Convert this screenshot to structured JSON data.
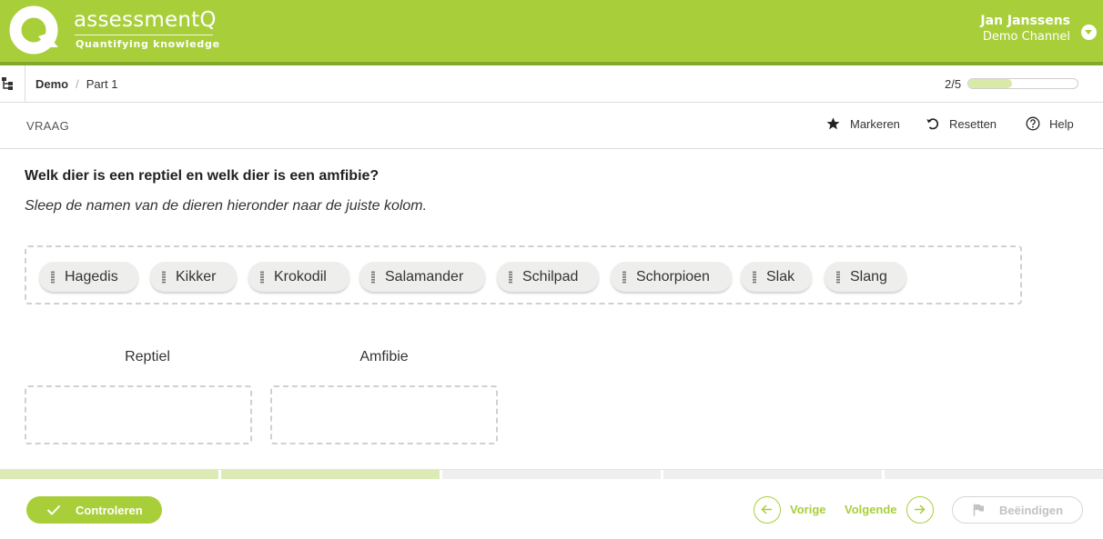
{
  "header": {
    "brand": "assessmentQ",
    "tagline": "Quantifying knowledge",
    "user_name": "Jan Janssens",
    "user_channel": "Demo Channel"
  },
  "breadcrumb": {
    "items": [
      "Demo",
      "Part 1"
    ],
    "separator": "/"
  },
  "progress": {
    "label": "2/5",
    "current": 2,
    "total": 5
  },
  "toolbar": {
    "section_label": "VRAAG",
    "mark_label": "Markeren",
    "reset_label": "Resetten",
    "help_label": "Help"
  },
  "question": {
    "title": "Welk dier is een reptiel en welk dier is een amfibie?",
    "instruction": "Sleep de namen van de dieren hieronder naar de juiste kolom."
  },
  "options": [
    "Hagedis",
    "Kikker",
    "Krokodil",
    "Salamander",
    "Schilpad",
    "Schorpioen",
    "Slak",
    "Slang"
  ],
  "columns": [
    "Reptiel",
    "Amfibie"
  ],
  "segments": {
    "total": 5,
    "done": 2
  },
  "footer": {
    "check_label": "Controleren",
    "prev_label": "Vorige",
    "next_label": "Volgende",
    "finish_label": "Beëindigen"
  },
  "colors": {
    "brand": "#a8cf3a",
    "brand_dark": "#83a92a",
    "progress_fill": "#d8e9a8",
    "disabled": "#c2c2c2"
  },
  "icons": {
    "logo": "q-logo-icon",
    "user_menu": "chevron-down-icon",
    "tree": "tree-icon",
    "mark": "star-icon",
    "reset": "reset-icon",
    "help": "help-circle-icon",
    "drag": "drag-handle-icon",
    "check": "checkmark-icon",
    "prev": "arrow-left-icon",
    "next": "arrow-right-icon",
    "finish": "flag-icon"
  }
}
